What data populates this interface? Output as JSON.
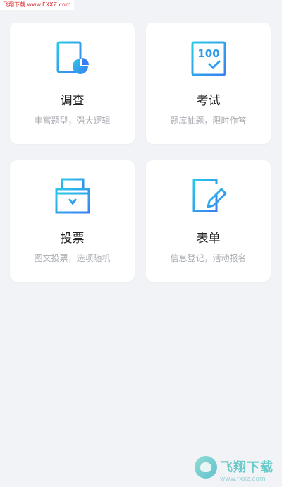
{
  "watermark": {
    "top_left_text": "飞翔下载 www.FXXZ.com",
    "brand_name": "飞翔下载",
    "brand_url": "www.fxxz.com"
  },
  "colors": {
    "background": "#f1f3f6",
    "card": "#ffffff",
    "accent_gradient_start": "#28c8e6",
    "accent_gradient_end": "#3a7ff2"
  },
  "cards": [
    {
      "title": "调查",
      "subtitle": "丰富题型，强大逻辑",
      "icon": "survey-chart-document-icon"
    },
    {
      "title": "考试",
      "subtitle": "题库抽题，限时作答",
      "icon": "exam-score-100-icon"
    },
    {
      "title": "投票",
      "subtitle": "图文投票，选项随机",
      "icon": "ballot-box-icon"
    },
    {
      "title": "表单",
      "subtitle": "信息登记，活动报名",
      "icon": "form-edit-pen-icon"
    }
  ]
}
